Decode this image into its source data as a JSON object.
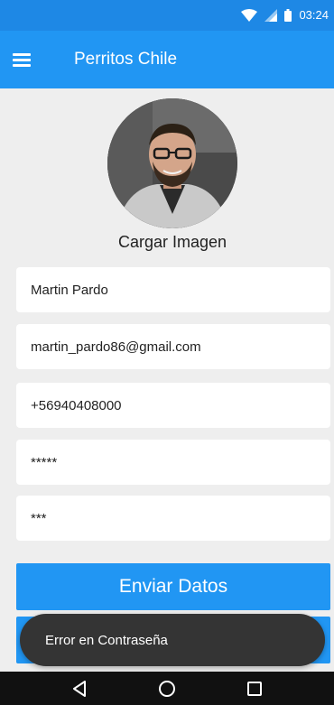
{
  "status_bar": {
    "time": "03:24",
    "icons": [
      "wifi-icon",
      "signal-icon",
      "battery-icon"
    ],
    "color": "#1e88e5"
  },
  "app_bar": {
    "title": "Perritos Chile",
    "menu_icon": "menu-icon",
    "color": "#2196f3"
  },
  "profile": {
    "caption": "Cargar Imagen"
  },
  "form": {
    "name": "Martin Pardo",
    "email": "martin_pardo86@gmail.com",
    "phone": "+56940408000",
    "password": "*****",
    "password_confirm": "***"
  },
  "actions": {
    "submit_label": "Enviar Datos"
  },
  "toast": {
    "message": "Error en Contraseña"
  },
  "nav": {
    "icons": [
      "back-icon",
      "home-icon",
      "recents-icon"
    ]
  }
}
